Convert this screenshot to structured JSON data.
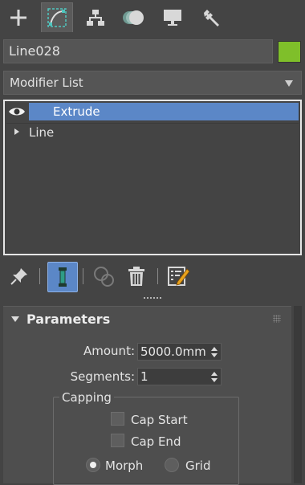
{
  "tabs": [
    {
      "name": "create",
      "icon": "plus-icon"
    },
    {
      "name": "modify",
      "icon": "modify-curve-icon"
    },
    {
      "name": "hierarchy",
      "icon": "hierarchy-icon"
    },
    {
      "name": "motion",
      "icon": "motion-icon"
    },
    {
      "name": "display",
      "icon": "display-monitor-icon"
    },
    {
      "name": "utilities",
      "icon": "wrench-icon"
    }
  ],
  "object": {
    "name": "Line028",
    "color": "#7fbf2a"
  },
  "modifier_list": {
    "label": "Modifier List"
  },
  "stack": {
    "items": [
      {
        "label": "Extrude",
        "selected": true
      },
      {
        "label": "Line",
        "selected": false
      }
    ]
  },
  "toolbar": {
    "pin_icon": "pin-stack-icon",
    "show_end_result_icon": "show-end-result-icon",
    "make_unique_icon": "make-unique-icon",
    "remove_modifier_icon": "trash-icon",
    "configure_sets_icon": "configure-modifier-sets-icon"
  },
  "parameters": {
    "title": "Parameters",
    "amount_label": "Amount:",
    "amount_value": "5000.0mm",
    "segments_label": "Segments:",
    "segments_value": "1",
    "capping_title": "Capping",
    "cap_start_label": "Cap Start",
    "cap_start_checked": false,
    "cap_end_label": "Cap End",
    "cap_end_checked": false,
    "morph_label": "Morph",
    "grid_label": "Grid",
    "capping_mode": "Morph"
  }
}
